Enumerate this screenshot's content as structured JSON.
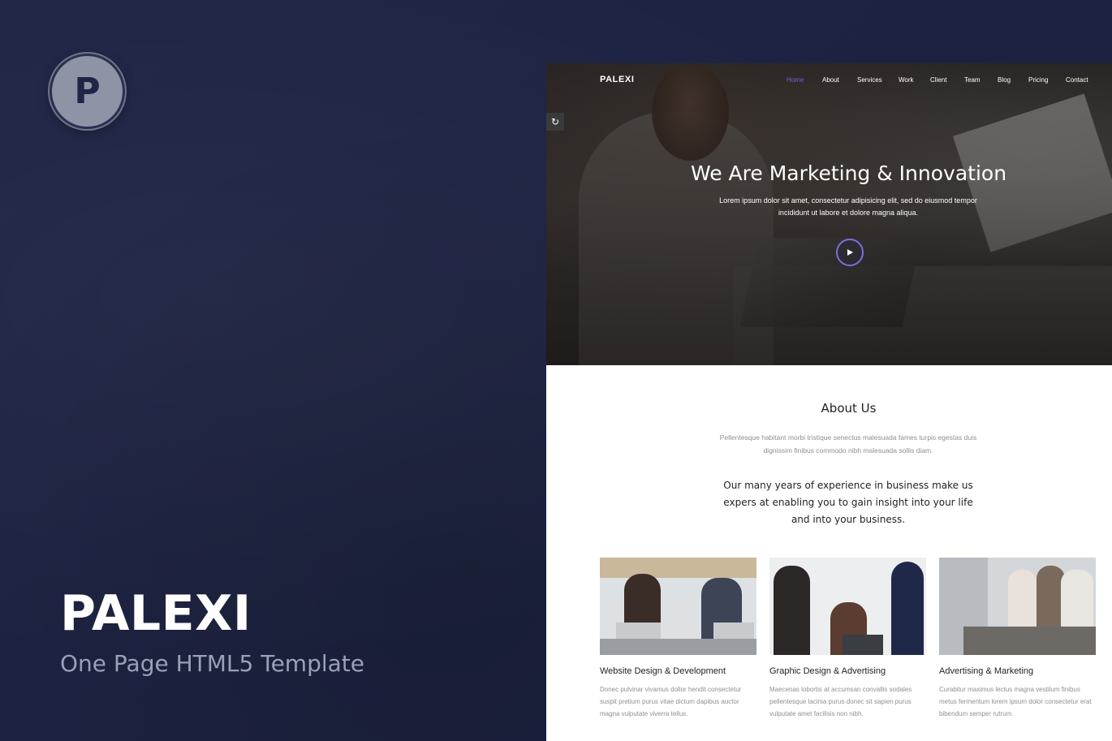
{
  "promo": {
    "logo_letter": "P",
    "title": "PALEXI",
    "subtitle": "One Page HTML5 Template"
  },
  "site": {
    "brand": "PALEXI",
    "nav": [
      "Home",
      "About",
      "Services",
      "Work",
      "Client",
      "Team",
      "Blog",
      "Pricing",
      "Contact"
    ],
    "active_nav": "Home",
    "accent_color": "#6b63d9",
    "hero": {
      "title": "We Are Marketing & Innovation",
      "text": "Lorem ipsum dolor sit amet, consectetur adipisicing elit, sed do eiusmod tempor incididunt ut labore et dolore magna aliqua.",
      "play_icon": "play-icon",
      "reload_icon": "reload-icon"
    },
    "about": {
      "title": "About Us",
      "subtitle": "Pellentesque habitant morbi tristique senectus malesuada fames turpis egestas duis dignissim finibus commodo nibh malesuada sollis diam.",
      "lead": "Our many years of experience in business make us expers at enabling you to gain insight into your life and into your business."
    },
    "services": [
      {
        "title": "Website Design & Development",
        "text": "Donec pulvinar vivamus dollor hendit consectetur suspit pretium purus vitae dictum dapibus auctor magna vulputate viverra tellus."
      },
      {
        "title": "Graphic Design & Advertising",
        "text": "Maecenas lobortis at accumsan convallis sodales pellentesque lacinia purus donec sit sapien purus vulputate amet facilisis non nibh."
      },
      {
        "title": "Advertising & Marketing",
        "text": "Curabitur maximus lectus magna vestilum finibus metus fermentum lorem ipsum dolor consectetur erat bibendum semper rutrum."
      }
    ]
  }
}
